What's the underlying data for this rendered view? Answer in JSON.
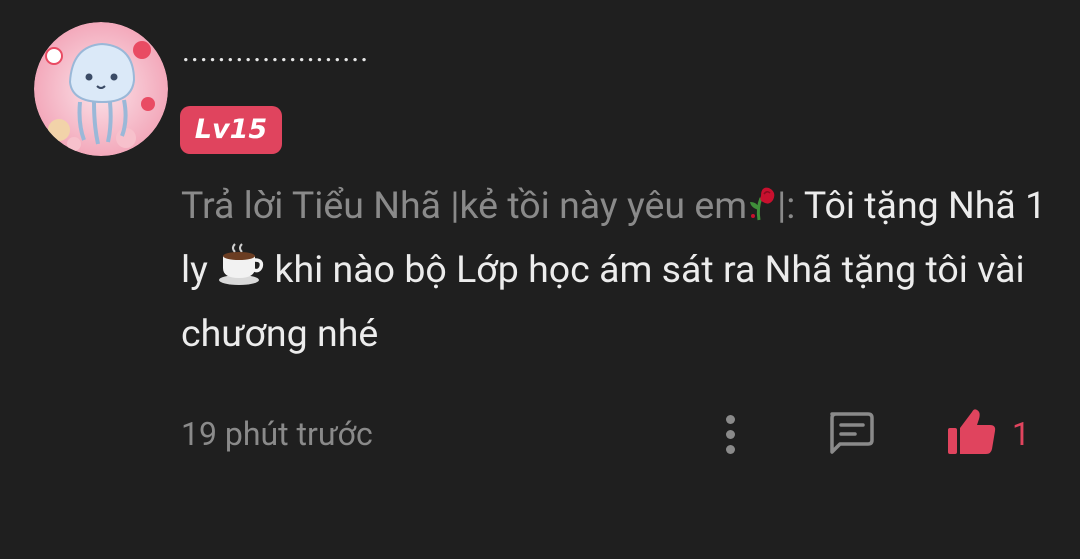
{
  "comment": {
    "username": ".....................",
    "level_badge": "Lv15",
    "reply_prefix": "Trả lời Tiểu Nhã |kẻ tồi này yêu em",
    "reply_suffix": "|: ",
    "text_part1": "Tôi tặng Nhã 1 ly ",
    "text_part2": " khi nào bộ Lớp học ám sát ra Nhã tặng tôi vài chương nhé",
    "timestamp": "19 phút trước",
    "like_count": "1"
  },
  "icons": {
    "more": "more-vertical-icon",
    "reply": "comment-icon",
    "like": "thumbs-up-icon",
    "rose": "wilted-rose-icon",
    "coffee": "hot-beverage-icon"
  },
  "colors": {
    "background": "#1f1f1f",
    "accent": "#e0445e",
    "muted": "#8a8a8a",
    "text": "#ececec"
  }
}
